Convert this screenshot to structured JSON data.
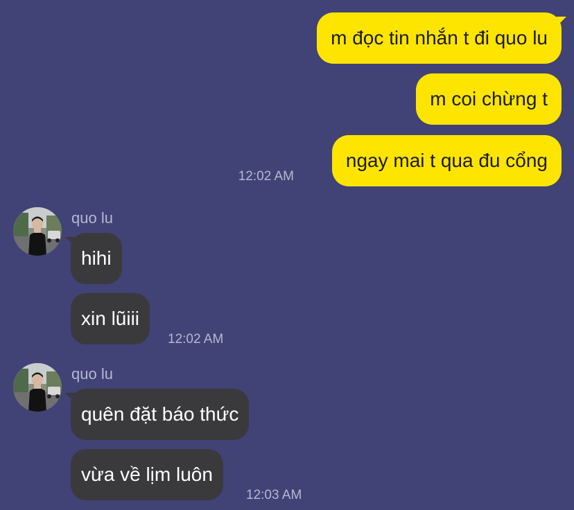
{
  "colors": {
    "background": "#414276",
    "outgoing_bubble": "#fee500",
    "incoming_bubble": "#3a3a3c",
    "meta_text": "#b7b8d2"
  },
  "outgoing": {
    "messages": [
      "m đọc tin nhắn t đi quo lu",
      "m coi chừng t",
      "ngay mai t qua đu cổng"
    ],
    "time": "12:02 AM"
  },
  "groups": [
    {
      "sender": "quo lu",
      "avatar_icon": "profile-photo",
      "messages": [
        "hihi",
        "xin lũiii"
      ],
      "time": "12:02 AM"
    },
    {
      "sender": "quo lu",
      "avatar_icon": "profile-photo",
      "messages": [
        "quên đặt báo thức",
        "vừa về lịm luôn"
      ],
      "time": "12:03 AM"
    }
  ]
}
